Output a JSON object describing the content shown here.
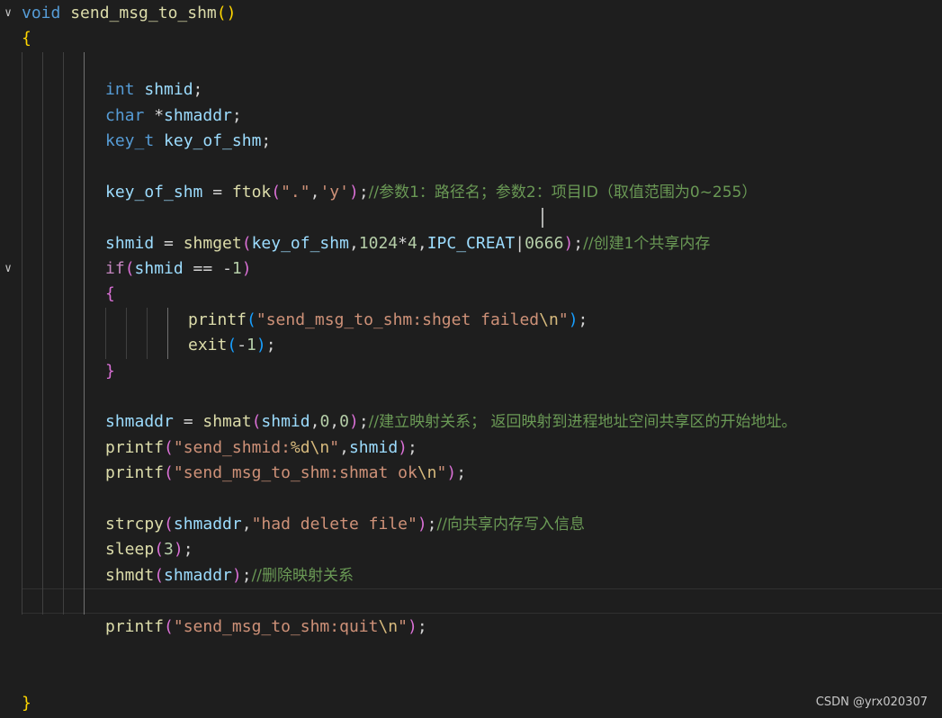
{
  "editor": {
    "language": "c",
    "colors": {
      "background": "#1e1e1e",
      "keyword": "#569cd6",
      "control": "#c586c0",
      "function": "#dcdcaa",
      "variable": "#9cdcfe",
      "string": "#ce9178",
      "number": "#b5cea8",
      "comment": "#6a9955",
      "bracket_level1": "#ffd700",
      "bracket_level2": "#da70d6",
      "bracket_level3": "#179fff"
    },
    "fold_icon": "chevron-down-icon",
    "lines": [
      {
        "indent": 0,
        "fold": true,
        "tokens": [
          [
            "kw",
            "void"
          ],
          [
            "pl",
            " "
          ],
          [
            "fn",
            "send_msg_to_shm"
          ],
          [
            "br1",
            "()"
          ]
        ]
      },
      {
        "indent": 0,
        "tokens": [
          [
            "br1",
            "{"
          ]
        ]
      },
      {
        "indent": 0,
        "tokens": []
      },
      {
        "indent": 1,
        "tokens": [
          [
            "kw",
            "int"
          ],
          [
            "pl",
            " "
          ],
          [
            "var",
            "shmid"
          ],
          [
            "pl",
            ";"
          ]
        ]
      },
      {
        "indent": 1,
        "tokens": [
          [
            "kw",
            "char"
          ],
          [
            "pl",
            " *"
          ],
          [
            "var",
            "shmaddr"
          ],
          [
            "pl",
            ";"
          ]
        ]
      },
      {
        "indent": 1,
        "tokens": [
          [
            "kw",
            "key_t"
          ],
          [
            "pl",
            " "
          ],
          [
            "var",
            "key_of_shm"
          ],
          [
            "pl",
            ";"
          ]
        ]
      },
      {
        "indent": 1,
        "tokens": []
      },
      {
        "indent": 1,
        "tokens": [
          [
            "var",
            "key_of_shm"
          ],
          [
            "pl",
            " = "
          ],
          [
            "fn",
            "ftok"
          ],
          [
            "br2",
            "("
          ],
          [
            "str",
            "\".\""
          ],
          [
            "pl",
            ","
          ],
          [
            "str",
            "'y'"
          ],
          [
            "br2",
            ")"
          ],
          [
            "pl",
            ";"
          ],
          [
            "cmt",
            "//参数1：路径名；参数2：项目ID（取值范围为0~255）"
          ]
        ]
      },
      {
        "indent": 1,
        "tokens": []
      },
      {
        "indent": 1,
        "tokens": [
          [
            "var",
            "shmid"
          ],
          [
            "pl",
            " = "
          ],
          [
            "fn",
            "shmget"
          ],
          [
            "br2",
            "("
          ],
          [
            "var",
            "key_of_shm"
          ],
          [
            "pl",
            ","
          ],
          [
            "num",
            "1024"
          ],
          [
            "pl",
            "*"
          ],
          [
            "num",
            "4"
          ],
          [
            "pl",
            ","
          ],
          [
            "var",
            "IPC_CREAT"
          ],
          [
            "pl",
            "|"
          ],
          [
            "num",
            "0666"
          ],
          [
            "br2",
            ")"
          ],
          [
            "pl",
            ";"
          ],
          [
            "cmt",
            "//创建1个共享内存"
          ]
        ]
      },
      {
        "indent": 1,
        "fold": true,
        "tokens": [
          [
            "ctrl",
            "if"
          ],
          [
            "br2",
            "("
          ],
          [
            "var",
            "shmid"
          ],
          [
            "pl",
            " == "
          ],
          [
            "pl",
            "-"
          ],
          [
            "num",
            "1"
          ],
          [
            "br2",
            ")"
          ]
        ]
      },
      {
        "indent": 1,
        "tokens": [
          [
            "br2",
            "{"
          ]
        ]
      },
      {
        "indent": 2,
        "tokens": [
          [
            "fn",
            "printf"
          ],
          [
            "br3",
            "("
          ],
          [
            "str",
            "\"send_msg_to_shm:shget failed"
          ],
          [
            "esc",
            "\\n"
          ],
          [
            "str",
            "\""
          ],
          [
            "br3",
            ")"
          ],
          [
            "pl",
            ";"
          ]
        ]
      },
      {
        "indent": 2,
        "tokens": [
          [
            "fn",
            "exit"
          ],
          [
            "br3",
            "("
          ],
          [
            "pl",
            "-"
          ],
          [
            "num",
            "1"
          ],
          [
            "br3",
            ")"
          ],
          [
            "pl",
            ";"
          ]
        ]
      },
      {
        "indent": 1,
        "tokens": [
          [
            "br2",
            "}"
          ]
        ]
      },
      {
        "indent": 1,
        "tokens": []
      },
      {
        "indent": 1,
        "tokens": [
          [
            "var",
            "shmaddr"
          ],
          [
            "pl",
            " = "
          ],
          [
            "fn",
            "shmat"
          ],
          [
            "br2",
            "("
          ],
          [
            "var",
            "shmid"
          ],
          [
            "pl",
            ","
          ],
          [
            "num",
            "0"
          ],
          [
            "pl",
            ","
          ],
          [
            "num",
            "0"
          ],
          [
            "br2",
            ")"
          ],
          [
            "pl",
            ";"
          ],
          [
            "cmt",
            "//建立映射关系； 返回映射到进程地址空间共享区的开始地址。"
          ]
        ]
      },
      {
        "indent": 1,
        "tokens": [
          [
            "fn",
            "printf"
          ],
          [
            "br2",
            "("
          ],
          [
            "str",
            "\"send_shmid:"
          ],
          [
            "esc",
            "%d\\n"
          ],
          [
            "str",
            "\""
          ],
          [
            "pl",
            ","
          ],
          [
            "var",
            "shmid"
          ],
          [
            "br2",
            ")"
          ],
          [
            "pl",
            ";"
          ]
        ]
      },
      {
        "indent": 1,
        "tokens": [
          [
            "fn",
            "printf"
          ],
          [
            "br2",
            "("
          ],
          [
            "str",
            "\"send_msg_to_shm:shmat ok"
          ],
          [
            "esc",
            "\\n"
          ],
          [
            "str",
            "\""
          ],
          [
            "br2",
            ")"
          ],
          [
            "pl",
            ";"
          ]
        ]
      },
      {
        "indent": 1,
        "tokens": []
      },
      {
        "indent": 1,
        "tokens": [
          [
            "fn",
            "strcpy"
          ],
          [
            "br2",
            "("
          ],
          [
            "var",
            "shmaddr"
          ],
          [
            "pl",
            ","
          ],
          [
            "str",
            "\"had delete file\""
          ],
          [
            "br2",
            ")"
          ],
          [
            "pl",
            ";"
          ],
          [
            "cmt",
            "//向共享内存写入信息"
          ]
        ]
      },
      {
        "indent": 1,
        "tokens": [
          [
            "fn",
            "sleep"
          ],
          [
            "br2",
            "("
          ],
          [
            "num",
            "3"
          ],
          [
            "br2",
            ")"
          ],
          [
            "pl",
            ";"
          ]
        ]
      },
      {
        "indent": 1,
        "tokens": [
          [
            "fn",
            "shmdt"
          ],
          [
            "br2",
            "("
          ],
          [
            "var",
            "shmaddr"
          ],
          [
            "br2",
            ")"
          ],
          [
            "pl",
            ";"
          ],
          [
            "cmt",
            "//删除映射关系"
          ]
        ]
      },
      {
        "indent": 1,
        "current": true,
        "tokens": []
      },
      {
        "indent": 1,
        "tokens": [
          [
            "fn",
            "printf"
          ],
          [
            "br2",
            "("
          ],
          [
            "str",
            "\"send_msg_to_shm:quit"
          ],
          [
            "esc",
            "\\n"
          ],
          [
            "str",
            "\""
          ],
          [
            "br2",
            ")"
          ],
          [
            "pl",
            ";"
          ]
        ]
      },
      {
        "indent": 0,
        "tokens": []
      },
      {
        "indent": 0,
        "tokens": []
      },
      {
        "indent": 0,
        "tokens": [
          [
            "br1",
            "}"
          ]
        ]
      }
    ]
  },
  "watermark": "CSDN @yrx020307"
}
